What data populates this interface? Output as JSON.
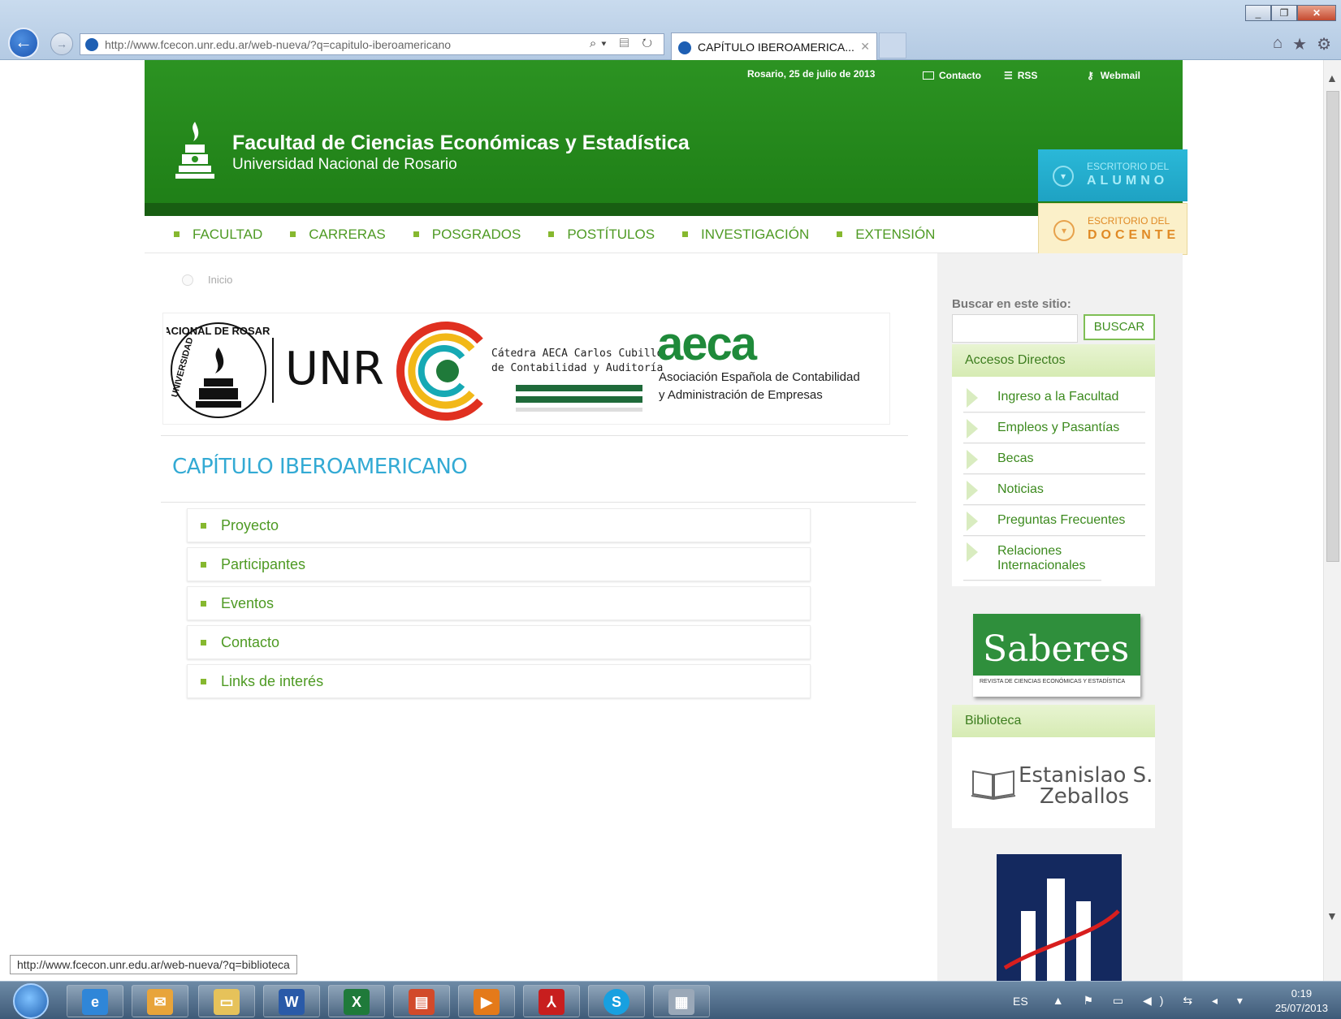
{
  "browser": {
    "url": "http://www.fcecon.unr.edu.ar/web-nueva/?q=capitulo-iberoamericano",
    "tab_title": "CAPÍTULO IBEROAMERICA...",
    "status_url": "http://www.fcecon.unr.edu.ar/web-nueva/?q=biblioteca"
  },
  "header": {
    "date": "Rosario, 25 de julio de 2013",
    "contact": "Contacto",
    "rss": "RSS",
    "webmail": "Webmail",
    "title": "Facultad de Ciencias Económicas y Estadística",
    "subtitle": "Universidad Nacional de Rosario"
  },
  "escritorio": {
    "alumno_l1": "ESCRITORIO DEL",
    "alumno_l2": "ALUMNO",
    "docente_l1": "ESCRITORIO DEL",
    "docente_l2": "DOCENTE"
  },
  "menu": [
    "FACULTAD",
    "CARRERAS",
    "POSGRADOS",
    "POSTÍTULOS",
    "INVESTIGACIÓN",
    "EXTENSIÓN"
  ],
  "breadcrumb": "Inicio",
  "banner": {
    "seal_top": "NACIONAL DE ROSARIO",
    "seal_left": "UNIVERSIDAD",
    "unr": "UNR",
    "catedra_l1": "Cátedra AECA Carlos Cubillo",
    "catedra_l2": "de Contabilidad y Auditoría",
    "aeca": "aeca",
    "aeca_l1": "Asociación Española de Contabilidad",
    "aeca_l2": "y Administración de Empresas"
  },
  "page_title": "CAPÍTULO IBEROAMERICANO",
  "subpages": [
    "Proyecto",
    "Participantes",
    "Eventos",
    "Contacto",
    "Links de interés"
  ],
  "sidebar": {
    "search_label": "Buscar en este sitio:",
    "search_button": "BUSCAR",
    "accesos_title": "Accesos Directos",
    "accesos": [
      "Ingreso a la Facultad",
      "Empleos y Pasantías",
      "Becas",
      "Noticias",
      "Preguntas Frecuentes",
      "Relaciones Internacionales"
    ],
    "saberes": "Saberes",
    "saberes_sub": "REVISTA DE CIENCIAS ECONÓMICAS Y ESTADÍSTICA",
    "biblioteca_title": "Biblioteca",
    "biblioteca_l1": "Estanislao S.",
    "biblioteca_l2": "Zeballos"
  },
  "taskbar": {
    "lang": "ES",
    "time": "0:19",
    "date": "25/07/2013"
  },
  "colors": {
    "header_green": "#2c9322",
    "menu_green": "#4e9a23",
    "title_blue": "#33aad4",
    "alumno_cyan": "#2ab8d8",
    "docente_cream": "#fbf0c9"
  }
}
